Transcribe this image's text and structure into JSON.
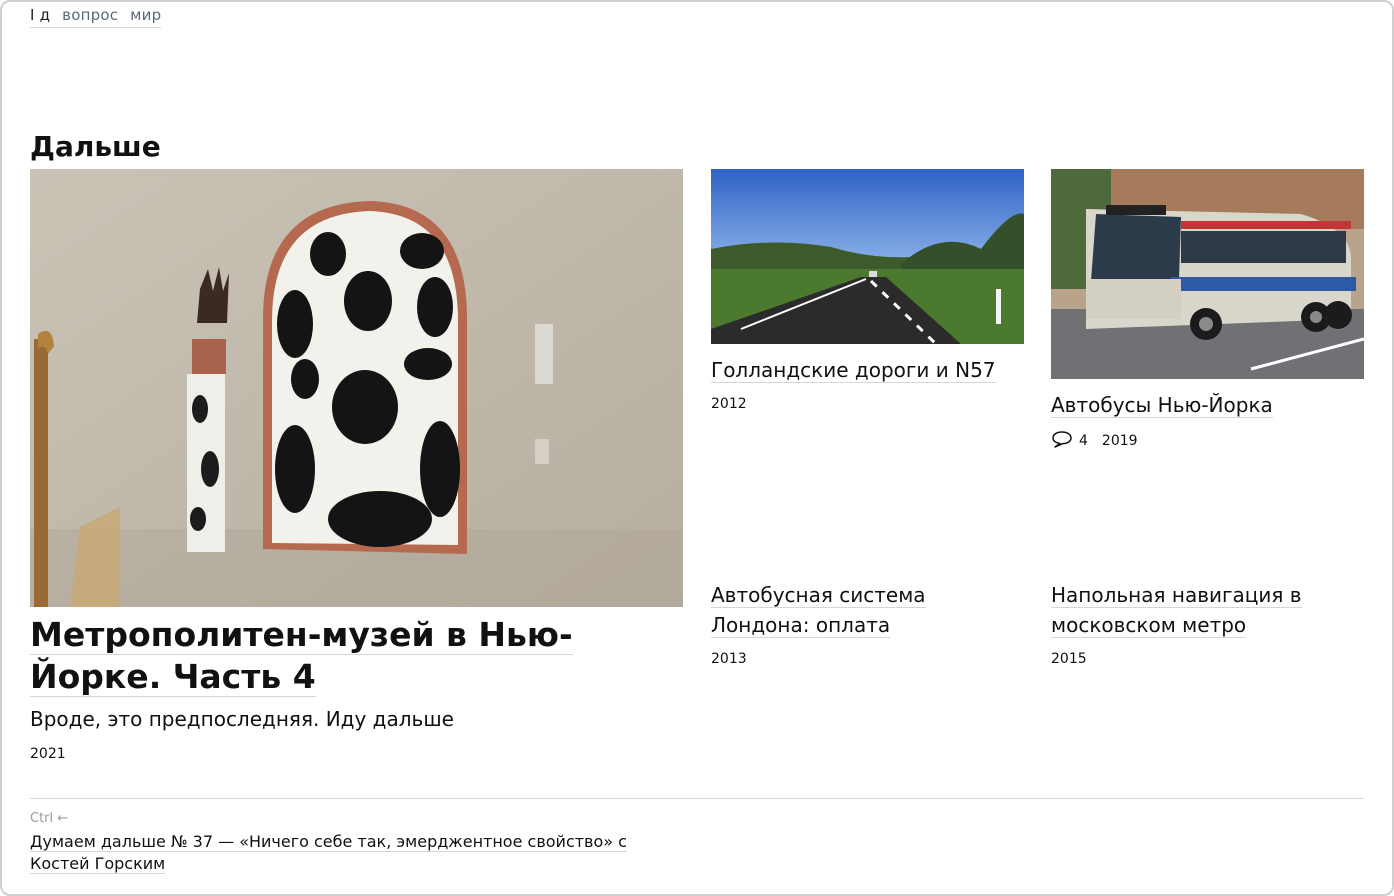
{
  "tags": {
    "first": "I д",
    "items": [
      "вопрос",
      "мир"
    ]
  },
  "section_title": "Дальше",
  "main_post": {
    "title": "Метрополитен-музей в Нью-Йорке. Часть 4",
    "description": "Вроде, это предпоследняя. Иду дальше",
    "year": "2021"
  },
  "posts": [
    {
      "title": "Голландские дороги и N57",
      "year": "2012"
    },
    {
      "title": "Автобусы Нью-Йорка",
      "year": "2019",
      "comments": "4"
    },
    {
      "title": "Автобусная система Лондона: оплата",
      "year": "2013"
    },
    {
      "title": "Напольная навигация в московском метро",
      "year": "2015"
    }
  ],
  "prev_nav": {
    "hint": "Ctrl ←",
    "title": "Думаем дальше № 37 — «Ничего себе так, эмерджентное свойство» с Костей Горским"
  },
  "icons": {
    "comments": "speech-bubble-icon"
  }
}
